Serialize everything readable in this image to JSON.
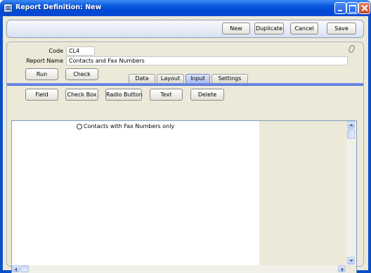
{
  "window": {
    "title": "Report Definition: New"
  },
  "toolbar": {
    "new_label": "New",
    "duplicate_label": "Duplicate",
    "cancel_label": "Cancel",
    "save_label": "Save"
  },
  "form": {
    "code_label": "Code",
    "code_value": "CL4",
    "report_name_label": "Report Name",
    "report_name_value": "Contacts and Fax Numbers",
    "run_label": "Run",
    "check_label": "Check"
  },
  "tabs": [
    {
      "label": "Data",
      "active": false
    },
    {
      "label": "Layout",
      "active": false
    },
    {
      "label": "Input",
      "active": true
    },
    {
      "label": "Settings",
      "active": false
    }
  ],
  "input_toolbar": {
    "field_label": "Field",
    "checkbox_label": "Check Box",
    "radio_label": "Radio Button",
    "text_label": "Text",
    "delete_label": "Delete"
  },
  "editor": {
    "radio_item_label": "Contacts with Fax Numbers only"
  },
  "colors": {
    "titlebar": "#0a5ae0",
    "active_tab": "#a9bdf2",
    "tab_underline": "#4f6fd8",
    "face": "#ece9d8"
  },
  "icons": [
    "app-icon",
    "minimize-icon",
    "maximize-icon",
    "close-icon",
    "paperclip-icon",
    "radio-icon"
  ]
}
